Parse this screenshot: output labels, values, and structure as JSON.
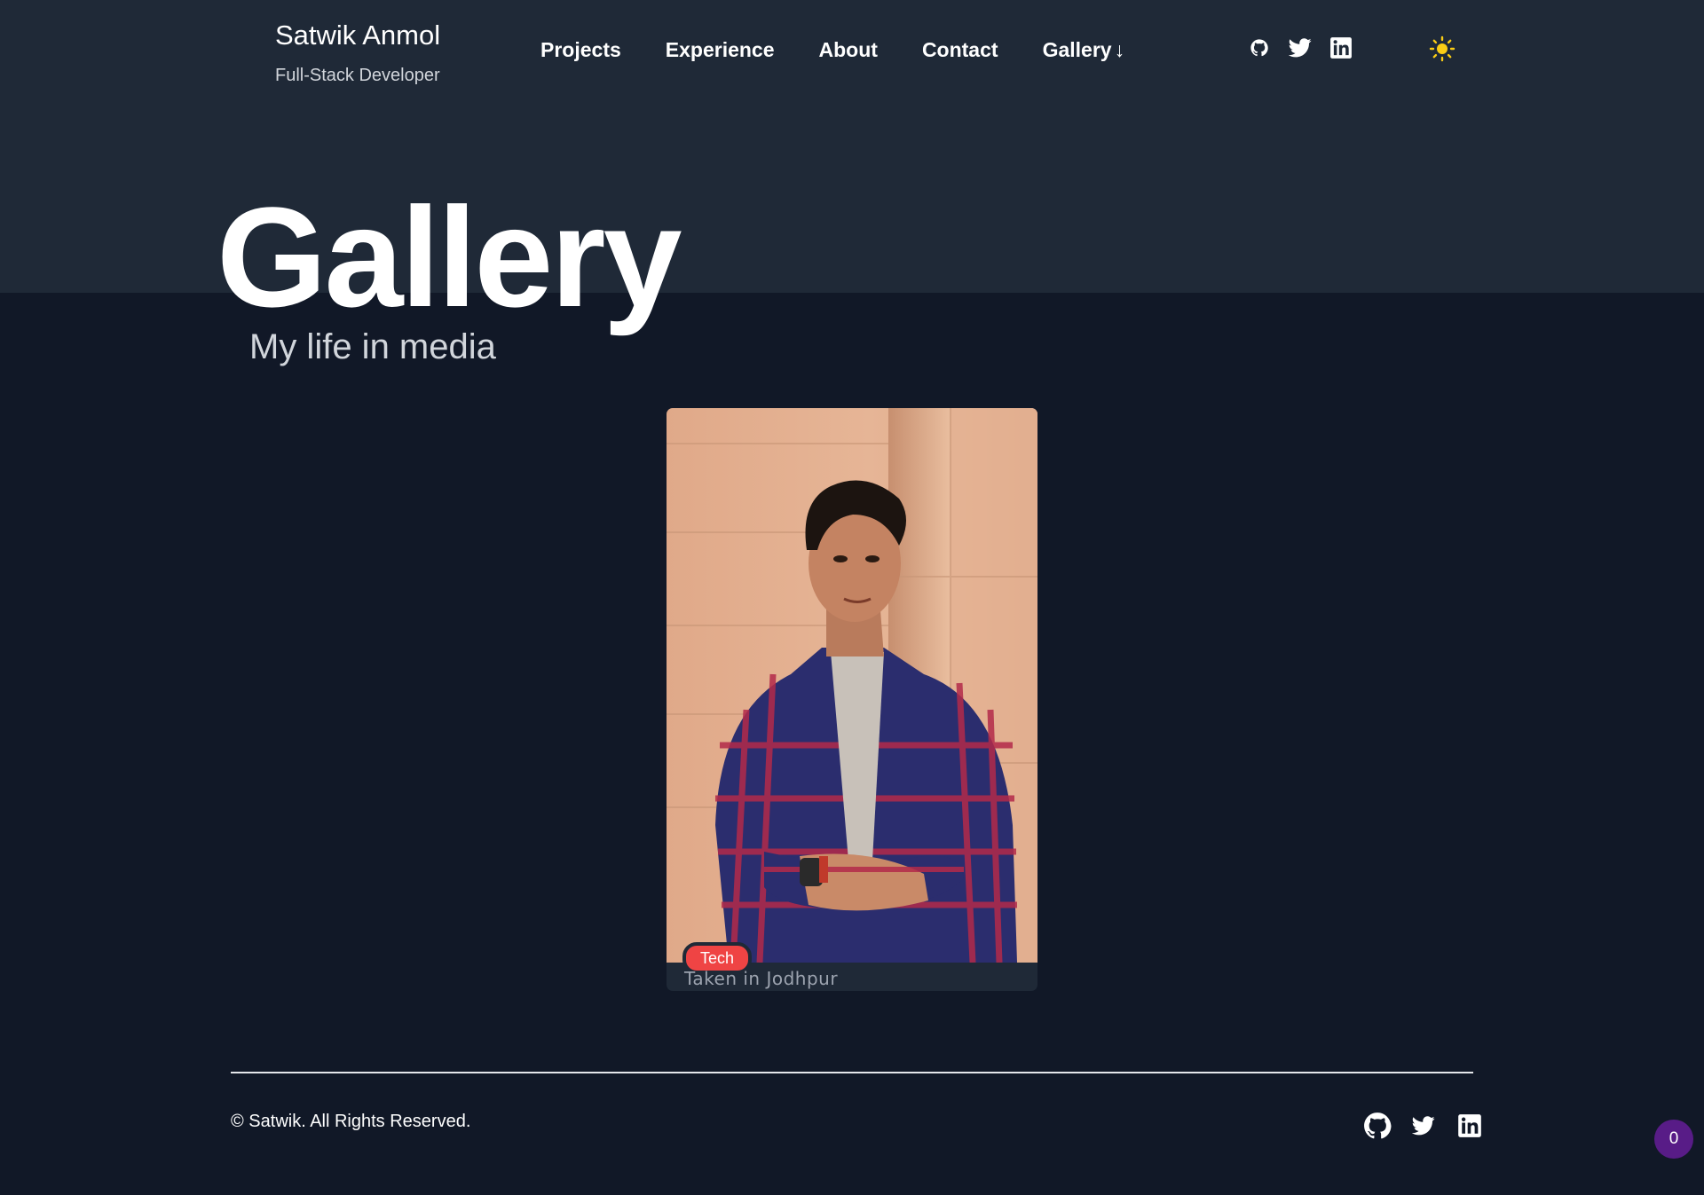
{
  "header": {
    "brand_name": "Satwik Anmol",
    "brand_subtitle": "Full-Stack Developer",
    "nav": [
      {
        "label": "Projects"
      },
      {
        "label": "Experience"
      },
      {
        "label": "About"
      },
      {
        "label": "Contact"
      },
      {
        "label": "Gallery",
        "suffix": "↓"
      }
    ],
    "social_icons": [
      "github-icon",
      "twitter-icon",
      "linkedin-icon"
    ],
    "theme_icon": "sun-icon",
    "theme_icon_color": "#facc15"
  },
  "hero": {
    "title": "Gallery",
    "subtitle": "My life in media"
  },
  "gallery": {
    "items": [
      {
        "image": "portrait photo of a young man in a plaid shirt, arms crossed, against a sandstone wall",
        "tag": "Tech",
        "tag_color": "#ef4444",
        "caption": "Taken in Jodhpur"
      }
    ]
  },
  "footer": {
    "copyright": "© Satwik. All Rights Reserved.",
    "social_icons": [
      "github-icon",
      "twitter-icon",
      "linkedin-icon"
    ]
  },
  "counter_badge": "0",
  "colors": {
    "page_bg": "#111827",
    "header_bg": "#1f2937",
    "counter_bg": "#581c87"
  }
}
